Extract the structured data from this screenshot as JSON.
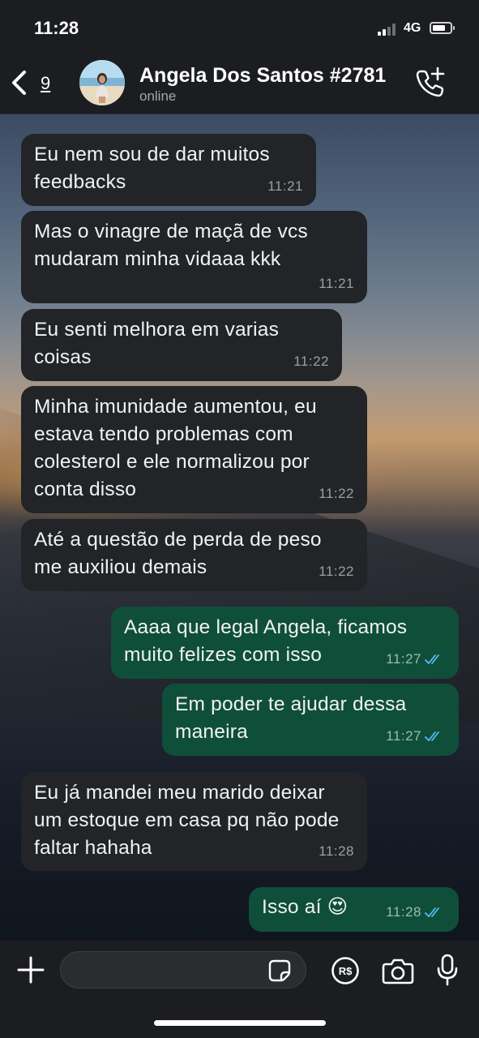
{
  "status_bar": {
    "time": "11:28",
    "network": "4G"
  },
  "header": {
    "unread_count": "9",
    "contact_name": "Angela Dos Santos #2781",
    "contact_status": "online"
  },
  "messages": [
    {
      "direction": "incoming",
      "text": "Eu nem sou de dar muitos feedbacks",
      "time": "11:21"
    },
    {
      "direction": "incoming",
      "text": "Mas o vinagre de maçã de vcs mudaram minha vidaaa kkk",
      "time": "11:21"
    },
    {
      "direction": "incoming",
      "text": "Eu senti melhora em varias coisas",
      "time": "11:22"
    },
    {
      "direction": "incoming",
      "text": "Minha imunidade aumentou, eu estava tendo problemas com colesterol e ele normalizou por conta disso",
      "time": "11:22"
    },
    {
      "direction": "incoming",
      "text": "Até a questão de perda de peso me auxiliou demais",
      "time": "11:22"
    },
    {
      "direction": "outgoing",
      "text": "Aaaa que legal Angela, ficamos muito felizes com isso",
      "time": "11:27",
      "status": "read"
    },
    {
      "direction": "outgoing",
      "text": "Em poder te ajudar dessa maneira",
      "time": "11:27",
      "status": "read"
    },
    {
      "direction": "incoming",
      "text": "Eu já mandei meu marido deixar um estoque em casa pq não pode faltar hahaha",
      "time": "11:28"
    },
    {
      "direction": "outgoing",
      "text": "Isso aí 😍",
      "time": "11:28",
      "status": "read"
    }
  ],
  "input_bar": {
    "message_input_value": "",
    "icons": [
      "plus-icon",
      "sticker-icon",
      "pay-icon",
      "camera-icon",
      "microphone-icon"
    ]
  },
  "colors": {
    "incoming_bubble": "#222427",
    "outgoing_bubble": "#0f4f3a",
    "read_ticks": "#53bdeb"
  }
}
